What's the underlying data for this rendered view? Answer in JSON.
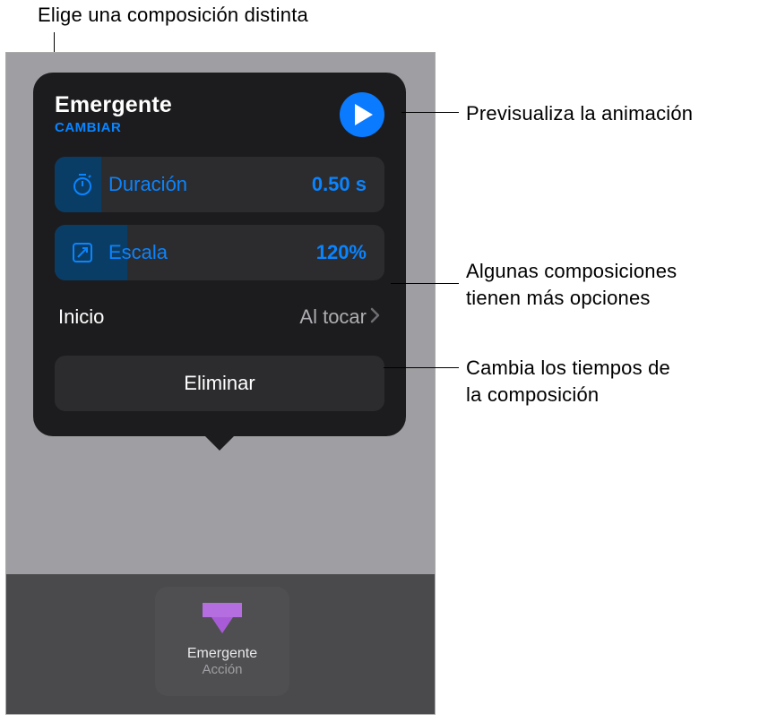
{
  "callouts": {
    "top": "Elige una composición distinta",
    "preview": "Previsualiza la animación",
    "options_l1": "Algunas composiciones",
    "options_l2": "tienen más opciones",
    "timing_l1": "Cambia los tiempos de",
    "timing_l2": "la composición"
  },
  "popover": {
    "title": "Emergente",
    "change": "CAMBIAR",
    "duration": {
      "label": "Duración",
      "value": "0.50 s"
    },
    "scale": {
      "label": "Escala",
      "value": "120%"
    },
    "start": {
      "label": "Inicio",
      "value": "Al tocar"
    },
    "delete": "Eliminar"
  },
  "build_tile": {
    "title": "Emergente",
    "subtitle": "Acción"
  },
  "colors": {
    "accent": "#0a84ff",
    "accent_dark": "#0a7aff",
    "shape": "#a85bd6"
  }
}
